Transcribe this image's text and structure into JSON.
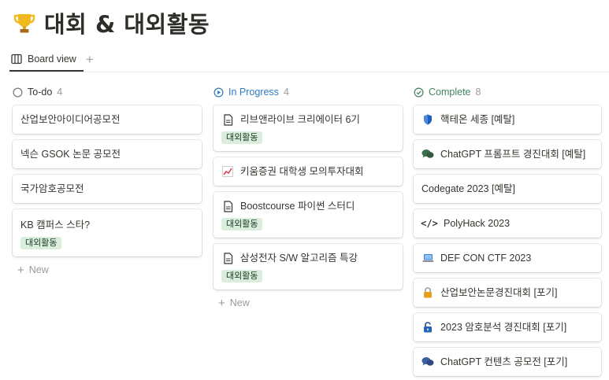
{
  "page": {
    "icon": "trophy-icon",
    "title": "대회 & 대외활동"
  },
  "views": {
    "active_label": "Board view",
    "add_icon": "plus-icon"
  },
  "columns": [
    {
      "status": "To-do",
      "count": "4",
      "icon": "circle-empty-icon",
      "color": "#787774",
      "cards": [
        {
          "title": "산업보안아이디어공모전"
        },
        {
          "title": "넥슨 GSOK 논문 공모전"
        },
        {
          "title": "국가암호공모전"
        },
        {
          "title": "KB 캠퍼스 스타?",
          "tag": "대외활동"
        }
      ],
      "new_label": "New"
    },
    {
      "status": "In Progress",
      "count": "4",
      "icon": "play-circle-icon",
      "color": "#2e7bbf",
      "cards": [
        {
          "icon": "document-icon",
          "title": "리브앤라이브 크리에이터 6기",
          "tag": "대외활동"
        },
        {
          "icon": "chart-increasing-icon",
          "title": "키움증권 대학생 모의투자대회"
        },
        {
          "icon": "document-icon",
          "title": "Boostcourse 파이썬 스터디",
          "tag": "대외활동"
        },
        {
          "icon": "document-icon",
          "title": "삼성전자 S/W 알고리즘 특강",
          "tag": "대외활동"
        }
      ],
      "new_label": "New"
    },
    {
      "status": "Complete",
      "count": "8",
      "icon": "check-circle-icon",
      "color": "#448361",
      "cards": [
        {
          "icon": "shield-icon",
          "title": "핵테온 세종 [예탈]"
        },
        {
          "icon": "chat-bubbles-icon",
          "title": "ChatGPT 프롬프트 경진대회 [예탈]"
        },
        {
          "title": "Codegate 2023 [예탈]"
        },
        {
          "icon": "code-icon",
          "title": "PolyHack 2023"
        },
        {
          "icon": "laptop-icon",
          "title": "DEF CON CTF 2023"
        },
        {
          "icon": "lock-icon",
          "title": "산업보안논문경진대회 [포기]"
        },
        {
          "icon": "unlock-icon",
          "title": "2023 암호분석 경진대회 [포기]"
        },
        {
          "icon": "chat-bubbles-icon",
          "title": "ChatGPT 컨텐츠 공모전 [포기]"
        }
      ]
    }
  ]
}
